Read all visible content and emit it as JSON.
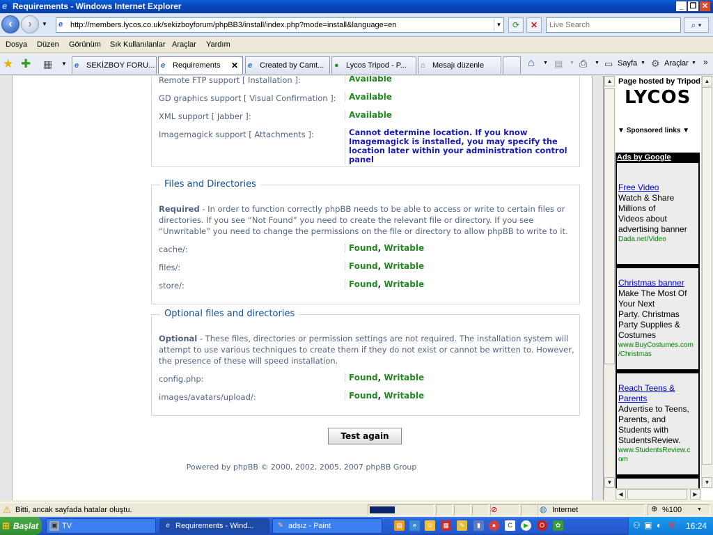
{
  "window": {
    "title": "Requirements - Windows Internet Explorer",
    "minimize_glyph": "_",
    "maximize_glyph": "❐",
    "close_glyph": "✕"
  },
  "address_bar": {
    "url": "http://members.lycos.co.uk/sekizboyforum/phpBB3/install/index.php?mode=install&language=en",
    "search_placeholder": "Live Search"
  },
  "menu": [
    "Dosya",
    "Düzen",
    "Görünüm",
    "Sık Kullanılanlar",
    "Araçlar",
    "Yardım"
  ],
  "tabs": [
    {
      "label": "SEKİZBOY FORU..."
    },
    {
      "label": "Requirements"
    },
    {
      "label": "Created by Camt..."
    },
    {
      "label": "Lycos Tripod - P..."
    },
    {
      "label": "Mesajı düzenle"
    }
  ],
  "toolbar_right": {
    "page_label": "Sayfa",
    "tools_label": "Araçlar"
  },
  "requirements": {
    "partial_row": {
      "label": "Remote FTP support [ Installation ]:",
      "value": "Available"
    },
    "rows": [
      {
        "label": "GD graphics support [ Visual Confirmation ]:",
        "value": "Available"
      },
      {
        "label": "XML support [ Jabber ]:",
        "value": "Available"
      },
      {
        "label": "Imagemagick support [ Attachments ]:",
        "value_lines": [
          "Cannot determine location. If you know",
          "Imagemagick is installed, you may specify the",
          "location later within your administration control",
          "panel"
        ]
      }
    ]
  },
  "files": {
    "legend": "Files and Directories",
    "desc_bold": "Required",
    "desc_lines": [
      " - In order to function correctly phpBB needs to be able to access or write to certain files or",
      "directories. If you see “Not Found” you need to create the relevant file or directory. If you see",
      "“Unwritable” you need to change the permissions on the file or directory to allow phpBB to write to it."
    ],
    "rows": [
      {
        "label": "cache/:",
        "found": "Found",
        "sep": ", ",
        "writable": "Writable"
      },
      {
        "label": "files/:",
        "found": "Found",
        "sep": ", ",
        "writable": "Writable"
      },
      {
        "label": "store/:",
        "found": "Found",
        "sep": ", ",
        "writable": "Writable"
      }
    ]
  },
  "optional": {
    "legend": "Optional files and directories",
    "desc_bold": "Optional",
    "desc_lines": [
      " - These files, directories or permission settings are not required. The installation system will",
      "attempt to use various techniques to create them if they do not exist or cannot be written to. However,",
      "the presence of these will speed installation."
    ],
    "rows": [
      {
        "label": "config.php:",
        "found": "Found",
        "sep": ", ",
        "writable": "Writable"
      },
      {
        "label": "images/avatars/upload/:",
        "found": "Found",
        "sep": ", ",
        "writable": "Writable"
      }
    ]
  },
  "test_button": "Test again",
  "footer": "Powered by phpBB © 2000, 2002, 2005, 2007 phpBB Group",
  "sidebar": {
    "hosted": "Page hosted by Tripod",
    "logo": "LYCOS",
    "sponsored": "Sponsored links",
    "ads_by": "Ads by Google",
    "ads": [
      {
        "title": "Free Video",
        "text_lines": [
          "Watch & Share",
          "Millions of",
          "Videos about",
          "advertising banner"
        ],
        "url_lines": [
          "Dada.net/Video"
        ]
      },
      {
        "title": "Christmas banner",
        "text_lines": [
          "Make The Most Of",
          "Your Next",
          "Party. Christmas",
          "Party Supplies &",
          "Costumes"
        ],
        "url_lines": [
          "www.BuyCostumes.com",
          "/Christmas"
        ]
      },
      {
        "title_lines": [
          "Reach Teens &",
          "Parents"
        ],
        "text_lines": [
          "Advertise to Teens,",
          "Parents, and",
          "Students with",
          "StudentsReview."
        ],
        "url_lines": [
          "www.StudentsReview.c",
          "om"
        ]
      }
    ]
  },
  "status": {
    "message": "Bitti, ancak sayfada hatalar oluştu.",
    "zone": "Internet",
    "zoom": "%100"
  },
  "taskbar": {
    "start": "Başlat",
    "items": [
      {
        "label": "TV"
      },
      {
        "label": "Requirements - Wind..."
      },
      {
        "label": "adsız - Paint"
      }
    ],
    "clock": "16:24"
  }
}
